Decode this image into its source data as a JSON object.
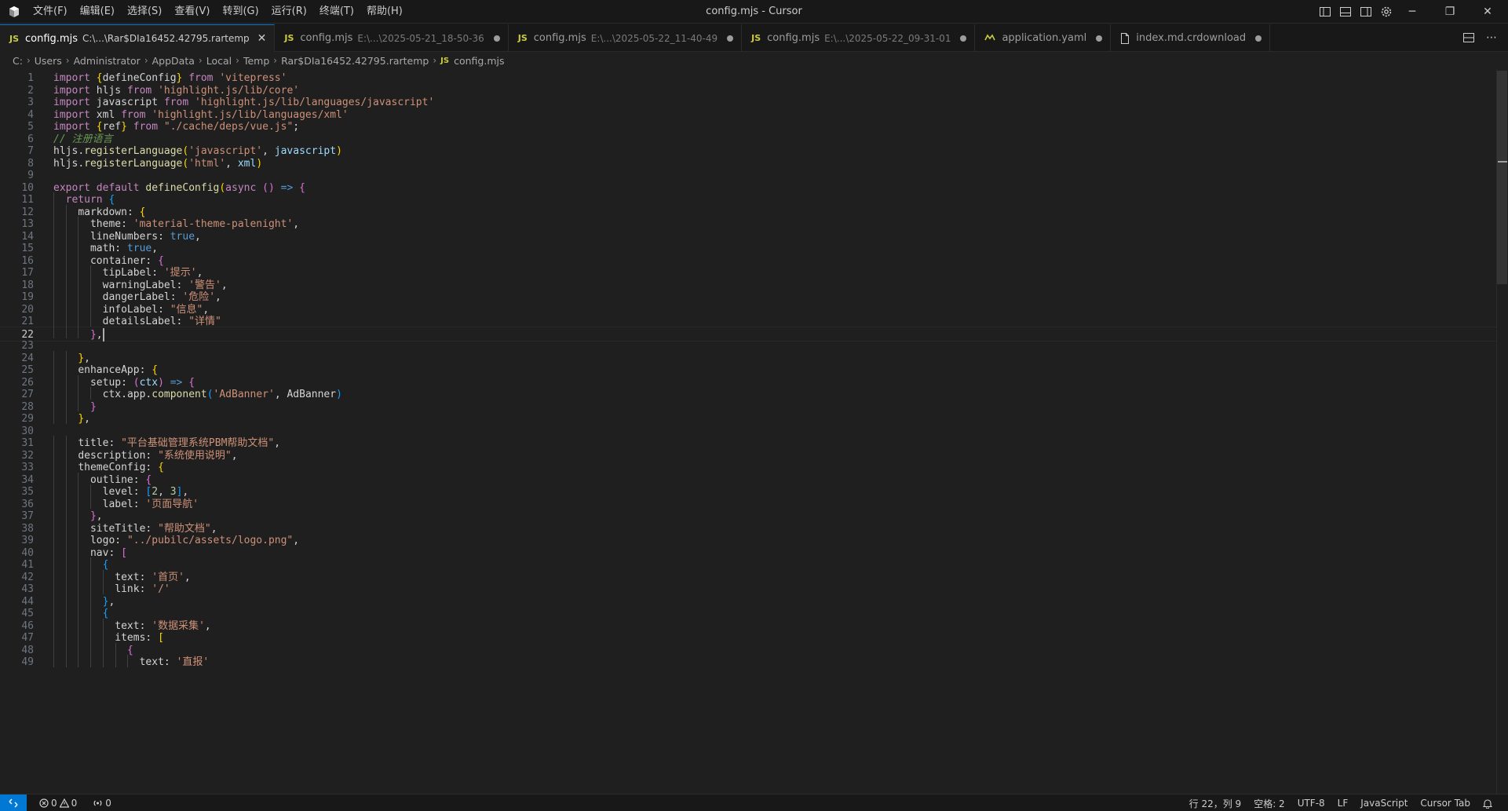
{
  "window": {
    "title": "config.mjs - Cursor"
  },
  "menu": [
    "文件(F)",
    "编辑(E)",
    "选择(S)",
    "查看(V)",
    "转到(G)",
    "运行(R)",
    "终端(T)",
    "帮助(H)"
  ],
  "tabs": [
    {
      "badge": "JS",
      "name": "config.mjs",
      "path": "C:\\...\\Rar$DIa16452.42795.rartemp",
      "active": true
    },
    {
      "badge": "JS",
      "name": "config.mjs",
      "path": "E:\\...\\2025-05-21_18-50-36"
    },
    {
      "badge": "JS",
      "name": "config.mjs",
      "path": "E:\\...\\2025-05-22_11-40-49"
    },
    {
      "badge": "JS",
      "name": "config.mjs",
      "path": "E:\\...\\2025-05-22_09-31-01"
    },
    {
      "badge": "yaml",
      "name": "application.yaml",
      "path": ""
    },
    {
      "badge": "file",
      "name": "index.md.crdownload",
      "path": ""
    }
  ],
  "breadcrumb": [
    "C:",
    "Users",
    "Administrator",
    "AppData",
    "Local",
    "Temp",
    "Rar$DIa16452.42795.rartemp",
    "config.mjs"
  ],
  "editor": {
    "current_line": 22,
    "lines": [
      "import {defineConfig} from 'vitepress'",
      "import hljs from 'highlight.js/lib/core'",
      "import javascript from 'highlight.js/lib/languages/javascript'",
      "import xml from 'highlight.js/lib/languages/xml'",
      "import {ref} from \"./cache/deps/vue.js\";",
      "// 注册语言",
      "hljs.registerLanguage('javascript', javascript)",
      "hljs.registerLanguage('html', xml)",
      "",
      "export default defineConfig(async () => {",
      "  return {",
      "    markdown: {",
      "      theme: 'material-theme-palenight',",
      "      lineNumbers: true,",
      "      math: true,",
      "      container: {",
      "        tipLabel: '提示',",
      "        warningLabel: '警告',",
      "        dangerLabel: '危险',",
      "        infoLabel: \"信息\",",
      "        detailsLabel: \"详情\"",
      "      },",
      "",
      "    },",
      "    enhanceApp: {",
      "      setup: (ctx) => {",
      "        ctx.app.component('AdBanner', AdBanner)",
      "      }",
      "    },",
      "",
      "    title: \"平台基础管理系统PBM帮助文档\",",
      "    description: \"系统使用说明\",",
      "    themeConfig: {",
      "      outline: {",
      "        level: [2, 3],",
      "        label: '页面导航'",
      "      },",
      "      siteTitle: \"帮助文档\",",
      "      logo: \"../pubilc/assets/logo.png\",",
      "      nav: [",
      "        {",
      "          text: '首页',",
      "          link: '/'",
      "        },",
      "        {",
      "          text: '数据采集',",
      "          items: [",
      "            {",
      "              text: '直报'"
    ]
  },
  "status": {
    "errors": "0",
    "warnings": "0",
    "ports": "0",
    "position": "行 22，列 9",
    "indent": "空格: 2",
    "encoding": "UTF-8",
    "eol": "LF",
    "language": "JavaScript",
    "cursor_tab": "Cursor Tab"
  },
  "colors": {
    "accent": "#0078d4",
    "background": "#1f1f1f",
    "chrome": "#181818"
  }
}
